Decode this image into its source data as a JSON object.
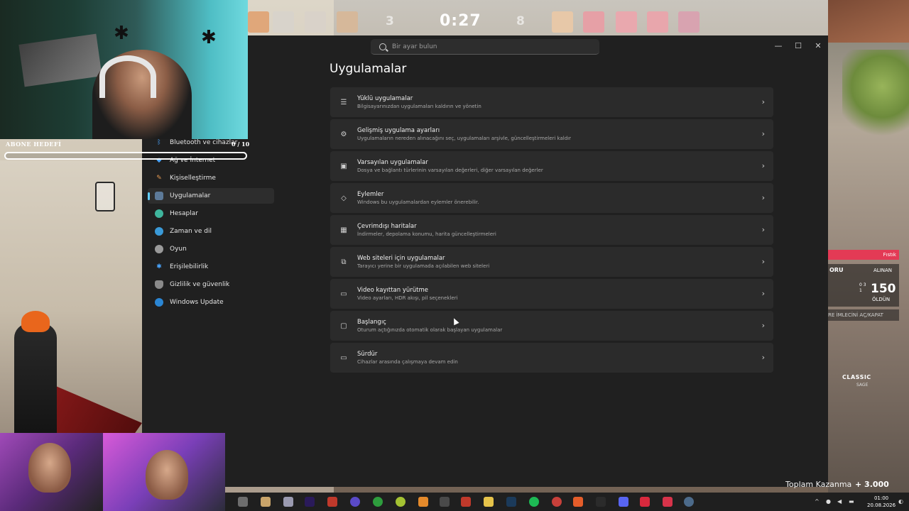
{
  "hud": {
    "score_left": "3",
    "timer": "0:27",
    "score_right": "8",
    "money_label": "Toplam Kazanma",
    "money_value": "+ 3.000",
    "buy_team": "Fıstık",
    "buy_left": "ORU",
    "buy_right": "ALINAN",
    "buy_value": "150",
    "buy_dead": "ÖLDÜN",
    "buy_counts": "0 3 1",
    "cursor_hint": "RE İMLECİNİ AÇ/KAPAT",
    "weapon": "CLASSIC",
    "weapon_owner": "SAGE"
  },
  "overlay": {
    "goal_label": "ABONE HEDEFİ",
    "goal_count": "0 / 10",
    "goal_progress": 0
  },
  "settings": {
    "search_placeholder": "Bir ayar bulun",
    "page_title": "Uygulamalar",
    "window_controls": {
      "minimize": "—",
      "maximize": "☐",
      "close": "✕"
    },
    "nav": [
      {
        "label": "Bluetooth ve cihazlar",
        "icon": "bluetooth-icon",
        "active": false
      },
      {
        "label": "Ağ ve İnternet",
        "icon": "network-icon",
        "active": false
      },
      {
        "label": "Kişiselleştirme",
        "icon": "brush-icon",
        "active": false
      },
      {
        "label": "Uygulamalar",
        "icon": "apps-icon",
        "active": true
      },
      {
        "label": "Hesaplar",
        "icon": "account-icon",
        "active": false
      },
      {
        "label": "Zaman ve dil",
        "icon": "globe-clock-icon",
        "active": false
      },
      {
        "label": "Oyun",
        "icon": "gamepad-icon",
        "active": false
      },
      {
        "label": "Erişilebilirlik",
        "icon": "accessibility-icon",
        "active": false
      },
      {
        "label": "Gizlilik ve güvenlik",
        "icon": "shield-icon",
        "active": false
      },
      {
        "label": "Windows Update",
        "icon": "update-icon",
        "active": false
      }
    ],
    "items": [
      {
        "title": "Yüklü uygulamalar",
        "subtitle": "Bilgisayarınızdan uygulamaları kaldırın ve yönetin",
        "icon": "list-icon"
      },
      {
        "title": "Gelişmiş uygulama ayarları",
        "subtitle": "Uygulamaların nereden alınacağını seç, uygulamaları arşivle, güncelleştirmeleri kaldır",
        "icon": "app-settings-icon"
      },
      {
        "title": "Varsayılan uygulamalar",
        "subtitle": "Dosya ve bağlantı türlerinin varsayılan değerleri, diğer varsayılan değerler",
        "icon": "default-apps-icon"
      },
      {
        "title": "Eylemler",
        "subtitle": "Windows bu uygulamalardan eylemler önerebilir.",
        "icon": "actions-icon"
      },
      {
        "title": "Çevrimdışı haritalar",
        "subtitle": "İndirmeler, depolama konumu, harita güncelleştirmeleri",
        "icon": "map-icon"
      },
      {
        "title": "Web siteleri için uygulamalar",
        "subtitle": "Tarayıcı yerine bir uygulamada açılabilen web siteleri",
        "icon": "web-app-icon"
      },
      {
        "title": "Video kayıttan yürütme",
        "subtitle": "Video ayarları, HDR akışı, pil seçenekleri",
        "icon": "video-icon"
      },
      {
        "title": "Başlangıç",
        "subtitle": "Oturum açtığınızda otomatik olarak başlayan uygulamalar",
        "icon": "startup-icon"
      },
      {
        "title": "Sürdür",
        "subtitle": "Cihazlar arasında çalışmaya devam edin",
        "icon": "resume-icon"
      }
    ]
  },
  "taskbar": {
    "time": "01:00",
    "date": "20.08.2026"
  },
  "colors": {
    "accent": "#60cdff",
    "settings_bg": "#202020",
    "card_bg": "#2b2b2b",
    "hud_red": "#e33a55"
  }
}
